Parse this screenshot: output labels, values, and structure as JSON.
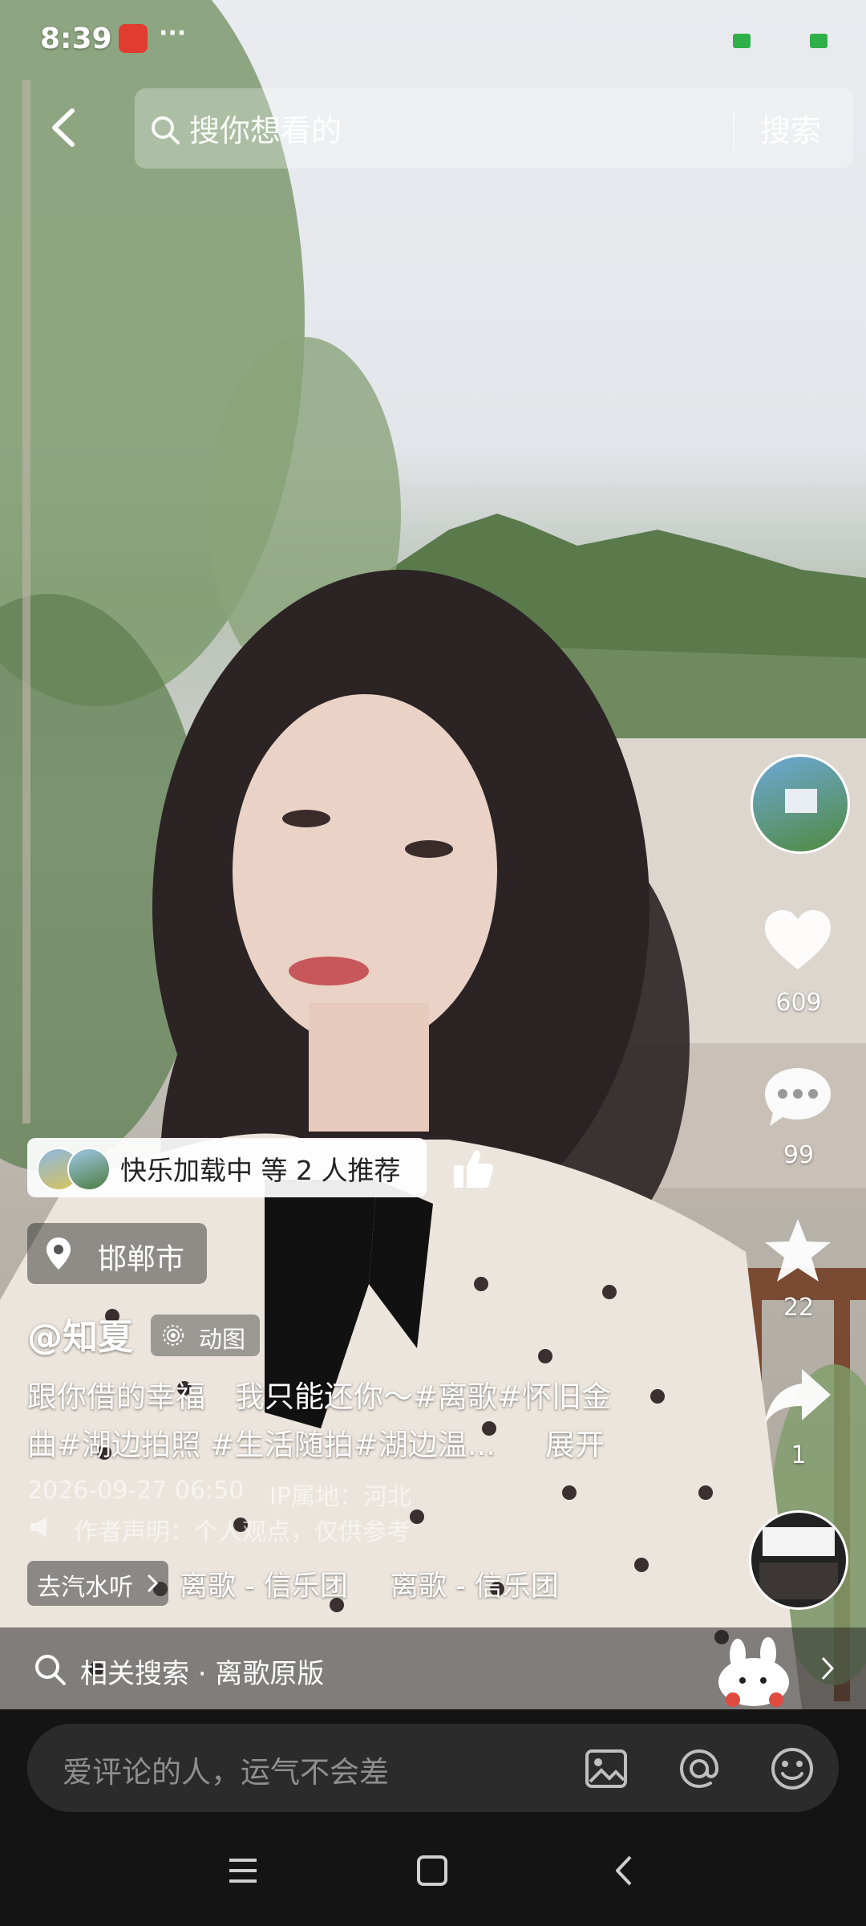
{
  "status_bar": {
    "time": "8:39",
    "more": "···"
  },
  "search": {
    "placeholder": "搜你想看的",
    "button": "搜索"
  },
  "right_rail": {
    "likes": "609",
    "comments": "99",
    "favorites": "22",
    "shares": "1"
  },
  "recommend": {
    "text": "快乐加载中 等 2 人推荐"
  },
  "location": {
    "text": "邯郸市"
  },
  "author": {
    "name": "@知夏",
    "tag": "动图"
  },
  "caption": {
    "line1": "跟你借的幸福　我只能还你～#离歌#怀旧金",
    "line2": "曲#湖边拍照 #生活随拍#湖边温...",
    "expand": "展开"
  },
  "meta": {
    "datetime": "2026-09-27 06:50",
    "ip": "IP属地：河北",
    "declaration": "作者声明：个人观点，仅供参考"
  },
  "music": {
    "chip": "去汽水听",
    "track1": "离歌 - 信乐团",
    "track2": "离歌 - 信乐团"
  },
  "related": {
    "text": "相关搜索 · 离歌原版"
  },
  "comment_box": {
    "placeholder": "爱评论的人，运气不会差"
  },
  "colors": {
    "accent_red": "#e23b2f",
    "signal_green": "#2fb04a"
  },
  "icons": [
    "back-icon",
    "search-icon",
    "heart-icon",
    "comment-icon",
    "star-icon",
    "share-icon",
    "thumb-up-icon",
    "location-pin-icon",
    "image-icon",
    "at-icon",
    "emoji-icon",
    "menu-icon",
    "home-icon",
    "nav-back-icon",
    "chevron-right-icon"
  ]
}
